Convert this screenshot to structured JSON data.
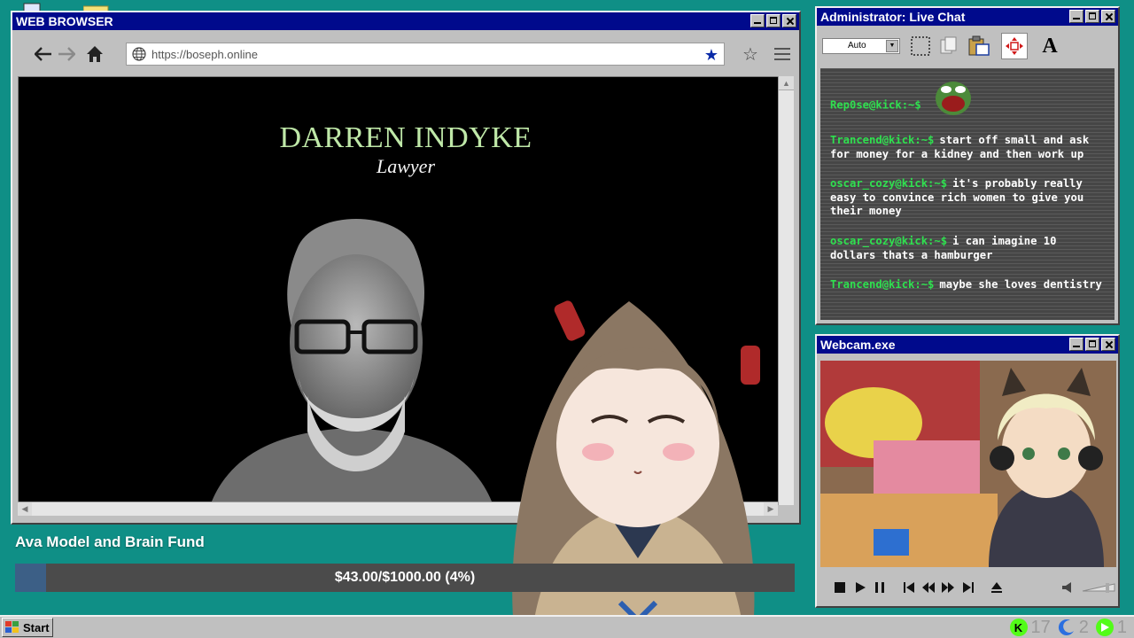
{
  "browser": {
    "title": "WEB BROWSER",
    "url": "https://boseph.online",
    "slide": {
      "name": "DARREN INDYKE",
      "role": "Lawyer"
    }
  },
  "fund": {
    "title": "Ava Model and Brain Fund",
    "progress_text": "$43.00/$1000.00 (4%)",
    "raised": 43.0,
    "goal": 1000.0,
    "percent": 4,
    "fill_color": "#3c5f86"
  },
  "chat": {
    "title": "Administrator: Live Chat",
    "font_select": "Auto",
    "messages": [
      {
        "user": "Rep0se@kick:~$",
        "text": "",
        "emote": "pepe-laugh-emote"
      },
      {
        "user": "Trancend@kick:~$",
        "text": "start off small and ask for money for a kidney and then work up"
      },
      {
        "user": "oscar_cozy@kick:~$",
        "text": "it's probably really easy to convince rich women to give you their money"
      },
      {
        "user": "oscar_cozy@kick:~$",
        "text": "i can imagine 10 dollars thats a hamburger"
      },
      {
        "user": "Trancend@kick:~$",
        "text": "maybe she loves dentistry"
      }
    ]
  },
  "webcam": {
    "title": "Webcam.exe"
  },
  "taskbar": {
    "start_label": "Start",
    "tray": [
      {
        "icon": "kick-icon",
        "count": "17",
        "color": "#53fc18"
      },
      {
        "icon": "moon-icon",
        "count": "2",
        "color": "#2b6fe0"
      },
      {
        "icon": "play-circle-icon",
        "count": "1",
        "color": "#53fc18"
      }
    ]
  },
  "colors": {
    "desktop": "#0f8f86",
    "titlebar": "#000a8c",
    "chat_username": "#2fe04f"
  }
}
